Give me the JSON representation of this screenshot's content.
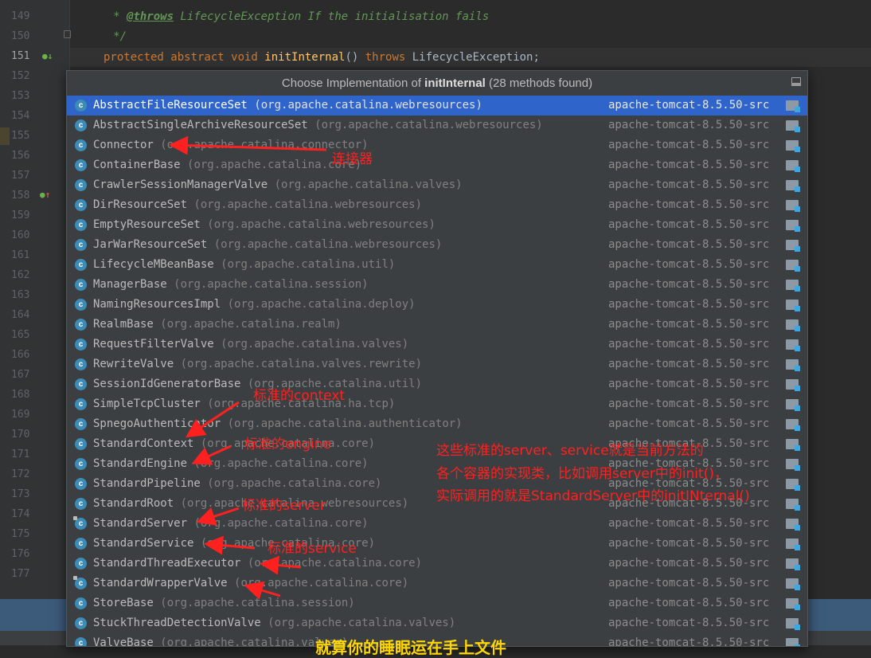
{
  "editor": {
    "line_numbers": [
      "149",
      "150",
      "151",
      "152",
      "153",
      "154",
      "155",
      "156",
      "157",
      "158",
      "159",
      "160",
      "161",
      "162",
      "163",
      "164",
      "165",
      "166",
      "167",
      "168",
      "169",
      "170",
      "171",
      "172",
      "173",
      "174",
      "175",
      "176",
      "177"
    ],
    "current_line": "151",
    "code": {
      "l149_star": "     * ",
      "l149_tag": "@throws",
      "l149_text": " LifecycleException If the initialisation fails",
      "l150": "     */",
      "l151_kw1": "protected abstract void ",
      "l151_fn": "initInternal",
      "l151_mid": "() ",
      "l151_kw2": "throws",
      "l151_end": " LifecycleException;"
    }
  },
  "popup": {
    "title_prefix": "Choose Implementation of ",
    "title_method": "initInternal",
    "title_suffix": " (28 methods found)",
    "rows": [
      {
        "name": "AbstractFileResourceSet",
        "pkg": "(org.apache.catalina.webresources)",
        "module": "apache-tomcat-8.5.50-src"
      },
      {
        "name": "AbstractSingleArchiveResourceSet",
        "pkg": "(org.apache.catalina.webresources)",
        "module": "apache-tomcat-8.5.50-src"
      },
      {
        "name": "Connector",
        "pkg": "(org.apache.catalina.connector)",
        "module": "apache-tomcat-8.5.50-src"
      },
      {
        "name": "ContainerBase",
        "pkg": "(org.apache.catalina.core)",
        "module": "apache-tomcat-8.5.50-src"
      },
      {
        "name": "CrawlerSessionManagerValve",
        "pkg": "(org.apache.catalina.valves)",
        "module": "apache-tomcat-8.5.50-src"
      },
      {
        "name": "DirResourceSet",
        "pkg": "(org.apache.catalina.webresources)",
        "module": "apache-tomcat-8.5.50-src"
      },
      {
        "name": "EmptyResourceSet",
        "pkg": "(org.apache.catalina.webresources)",
        "module": "apache-tomcat-8.5.50-src"
      },
      {
        "name": "JarWarResourceSet",
        "pkg": "(org.apache.catalina.webresources)",
        "module": "apache-tomcat-8.5.50-src"
      },
      {
        "name": "LifecycleMBeanBase",
        "pkg": "(org.apache.catalina.util)",
        "module": "apache-tomcat-8.5.50-src"
      },
      {
        "name": "ManagerBase",
        "pkg": "(org.apache.catalina.session)",
        "module": "apache-tomcat-8.5.50-src"
      },
      {
        "name": "NamingResourcesImpl",
        "pkg": "(org.apache.catalina.deploy)",
        "module": "apache-tomcat-8.5.50-src"
      },
      {
        "name": "RealmBase",
        "pkg": "(org.apache.catalina.realm)",
        "module": "apache-tomcat-8.5.50-src"
      },
      {
        "name": "RequestFilterValve",
        "pkg": "(org.apache.catalina.valves)",
        "module": "apache-tomcat-8.5.50-src"
      },
      {
        "name": "RewriteValve",
        "pkg": "(org.apache.catalina.valves.rewrite)",
        "module": "apache-tomcat-8.5.50-src"
      },
      {
        "name": "SessionIdGeneratorBase",
        "pkg": "(org.apache.catalina.util)",
        "module": "apache-tomcat-8.5.50-src"
      },
      {
        "name": "SimpleTcpCluster",
        "pkg": "(org.apache.catalina.ha.tcp)",
        "module": "apache-tomcat-8.5.50-src"
      },
      {
        "name": "SpnegoAuthenticator",
        "pkg": "(org.apache.catalina.authenticator)",
        "module": "apache-tomcat-8.5.50-src"
      },
      {
        "name": "StandardContext",
        "pkg": "(org.apache.catalina.core)",
        "module": "apache-tomcat-8.5.50-src"
      },
      {
        "name": "StandardEngine",
        "pkg": "(org.apache.catalina.core)",
        "module": "apache-tomcat-8.5.50-src"
      },
      {
        "name": "StandardPipeline",
        "pkg": "(org.apache.catalina.core)",
        "module": "apache-tomcat-8.5.50-src"
      },
      {
        "name": "StandardRoot",
        "pkg": "(org.apache.catalina.webresources)",
        "module": "apache-tomcat-8.5.50-src"
      },
      {
        "name": "StandardServer",
        "pkg": "(org.apache.catalina.core)",
        "module": "apache-tomcat-8.5.50-src"
      },
      {
        "name": "StandardService",
        "pkg": "(org.apache.catalina.core)",
        "module": "apache-tomcat-8.5.50-src"
      },
      {
        "name": "StandardThreadExecutor",
        "pkg": "(org.apache.catalina.core)",
        "module": "apache-tomcat-8.5.50-src"
      },
      {
        "name": "StandardWrapperValve",
        "pkg": "(org.apache.catalina.core)",
        "module": "apache-tomcat-8.5.50-src"
      },
      {
        "name": "StoreBase",
        "pkg": "(org.apache.catalina.session)",
        "module": "apache-tomcat-8.5.50-src"
      },
      {
        "name": "StuckThreadDetectionValve",
        "pkg": "(org.apache.catalina.valves)",
        "module": "apache-tomcat-8.5.50-src"
      },
      {
        "name": "ValveBase",
        "pkg": "(org.apache.catalina.valves)",
        "module": "apache-tomcat-8.5.50-src"
      }
    ],
    "selected_index": 0,
    "icon_letter": "c"
  },
  "annotations": {
    "connector": "连接器",
    "context": "标准的context",
    "engine": "标准的engine",
    "server": "标准的server",
    "service": "标准的service",
    "note_line1": "这些标准的server、service就是当前方法的",
    "note_line2": "各个容器的实现类，比如调用server中的init()，",
    "note_line3": "实际调用的就是StandardServer中的initINternal()",
    "bottom_text": "就算你的睡眠运在手上文件"
  },
  "colors": {
    "selection": "#2f65ca",
    "annotation_red": "#ff2020",
    "annotation_yellow": "#ffd700"
  }
}
